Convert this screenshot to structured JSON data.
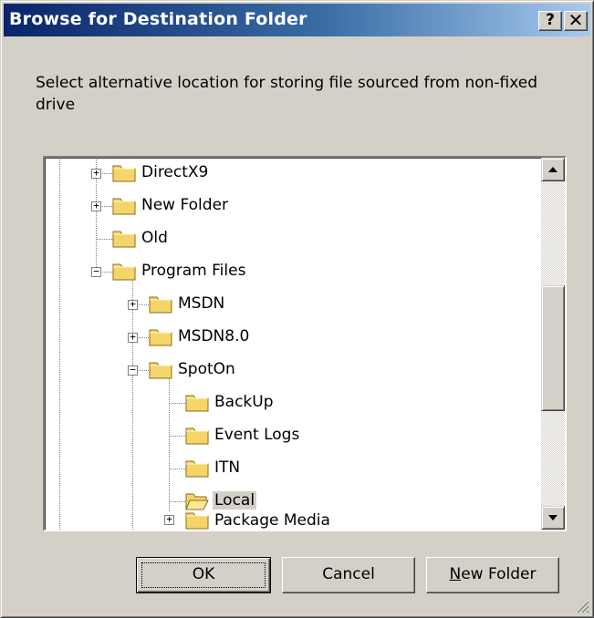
{
  "dialog": {
    "title": "Browse for Destination Folder",
    "help_button": "?",
    "close_button": "✕",
    "instruction": "Select alternative location for storing file sourced from non-fixed drive"
  },
  "tree": {
    "items": [
      {
        "label": "DirectX9",
        "expander": "+"
      },
      {
        "label": "New Folder",
        "expander": "+"
      },
      {
        "label": "Old",
        "expander": ""
      },
      {
        "label": "Program Files",
        "expander": "−"
      },
      {
        "label": "MSDN",
        "expander": "+"
      },
      {
        "label": "MSDN8.0",
        "expander": "+"
      },
      {
        "label": "SpotOn",
        "expander": "−"
      },
      {
        "label": "BackUp",
        "expander": ""
      },
      {
        "label": "Event Logs",
        "expander": ""
      },
      {
        "label": "ITN",
        "expander": ""
      },
      {
        "label": "Local",
        "expander": "",
        "selected": true
      },
      {
        "label": "Package Media",
        "expander": "+"
      }
    ]
  },
  "buttons": {
    "ok": "OK",
    "cancel": "Cancel",
    "new_folder_mnemonic": "N",
    "new_folder_rest": "ew Folder"
  },
  "colors": {
    "title_start": "#0a246a",
    "title_end": "#a6caf0",
    "face": "#d4d0c8",
    "folder": "#f5d56a"
  }
}
